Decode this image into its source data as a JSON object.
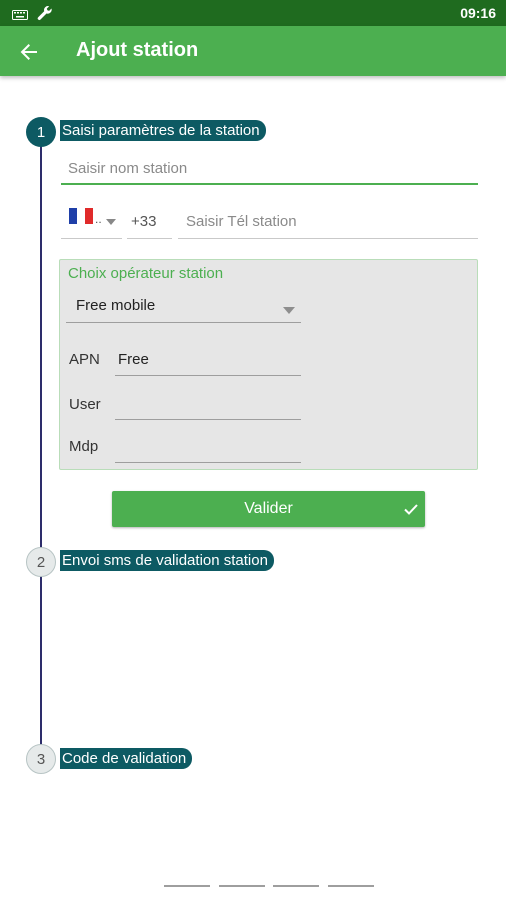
{
  "status_bar": {
    "time": "09:16",
    "icons": [
      "keyboard-icon",
      "wrench-icon"
    ]
  },
  "app_bar": {
    "title": "Ajout station",
    "back_icon": "arrow-left-icon"
  },
  "steps": [
    {
      "number": "1",
      "title": "Saisi paramètres de la station",
      "active": true
    },
    {
      "number": "2",
      "title": "Envoi sms de validation station",
      "active": false
    },
    {
      "number": "3",
      "title": "Code de validation",
      "active": false
    }
  ],
  "form": {
    "station_name_placeholder": "Saisir nom station",
    "country_flag": "france-flag-icon",
    "country_ellipsis": "..",
    "dial_code": "+33",
    "phone_placeholder": "Saisir Tél station"
  },
  "operator_panel": {
    "title": "Choix opérateur station",
    "selected_operator": "Free mobile",
    "apn_label": "APN",
    "apn_value": "Free",
    "user_label": "User",
    "user_value": "",
    "mdp_label": "Mdp",
    "mdp_value": ""
  },
  "validate_button": {
    "label": "Valider",
    "icon": "check-icon"
  },
  "code_input": {
    "digits": 4
  },
  "colors": {
    "status_bar": "#1f6b1f",
    "app_bar": "#4caf50",
    "step_accent": "#0d5a63",
    "timeline": "#2d2d6b"
  }
}
